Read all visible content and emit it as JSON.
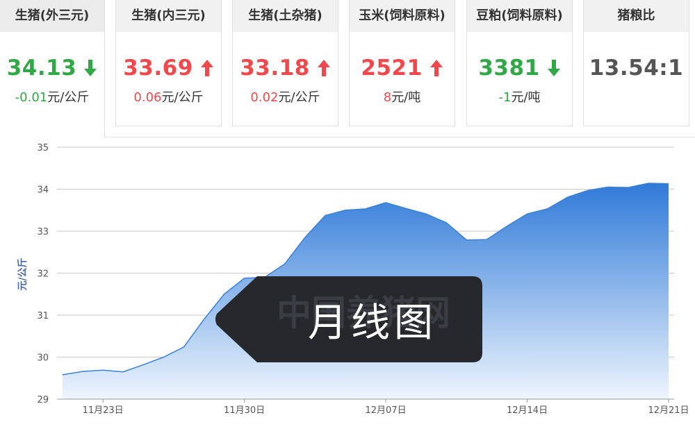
{
  "tabs": [
    {
      "label": "生猪(外三元)",
      "price": "34.13",
      "direction": "down",
      "change_value": "-0.01",
      "change_unit": "元/公斤",
      "active": true
    },
    {
      "label": "生猪(内三元)",
      "price": "33.69",
      "direction": "up",
      "change_value": "0.06",
      "change_unit": "元/公斤",
      "active": false
    },
    {
      "label": "生猪(土杂猪)",
      "price": "33.18",
      "direction": "up",
      "change_value": "0.02",
      "change_unit": "元/公斤",
      "active": false
    },
    {
      "label": "玉米(饲料原料)",
      "price": "2521",
      "direction": "up",
      "change_value": "8",
      "change_unit": "元/吨",
      "active": false
    },
    {
      "label": "豆粕(饲料原料)",
      "price": "3381",
      "direction": "down",
      "change_value": "-1",
      "change_unit": "元/吨",
      "active": false
    },
    {
      "label": "猪粮比",
      "price": "13.54:1",
      "direction": "none",
      "change_value": "",
      "change_unit": "",
      "active": false
    }
  ],
  "colors": {
    "up": "#f0484b",
    "down": "#2fa845",
    "line": "#3a80d8",
    "fill_top": "#2f7ad8",
    "fill_bottom": "#eef5fd"
  },
  "overlay": {
    "label": "月线图",
    "watermark": "中国养猪网"
  },
  "chart_data": {
    "type": "area",
    "ylabel": "元/公斤",
    "ylim": [
      29,
      35
    ],
    "yticks": [
      29,
      30,
      31,
      32,
      33,
      34,
      35
    ],
    "xticks": [
      "11月23日",
      "11月30日",
      "12月07日",
      "12月14日",
      "12月21日"
    ],
    "xtick_index": [
      2,
      9,
      16,
      23,
      30
    ],
    "x": [
      "11月21日",
      "11月22日",
      "11月23日",
      "11月24日",
      "11月25日",
      "11月26日",
      "11月27日",
      "11月28日",
      "11月29日",
      "11月30日",
      "12月01日",
      "12月02日",
      "12月03日",
      "12月04日",
      "12月05日",
      "12月06日",
      "12月07日",
      "12月08日",
      "12月09日",
      "12月10日",
      "12月11日",
      "12月12日",
      "12月13日",
      "12月14日",
      "12月15日",
      "12月16日",
      "12月17日",
      "12月18日",
      "12月19日",
      "12月20日",
      "12月21日"
    ],
    "values": [
      29.58,
      29.66,
      29.69,
      29.65,
      29.82,
      30.0,
      30.24,
      30.9,
      31.5,
      31.88,
      31.9,
      32.22,
      32.85,
      33.37,
      33.5,
      33.53,
      33.68,
      33.54,
      33.41,
      33.2,
      32.79,
      32.8,
      33.12,
      33.41,
      33.53,
      33.81,
      33.97,
      34.05,
      34.04,
      34.14,
      34.13
    ]
  }
}
